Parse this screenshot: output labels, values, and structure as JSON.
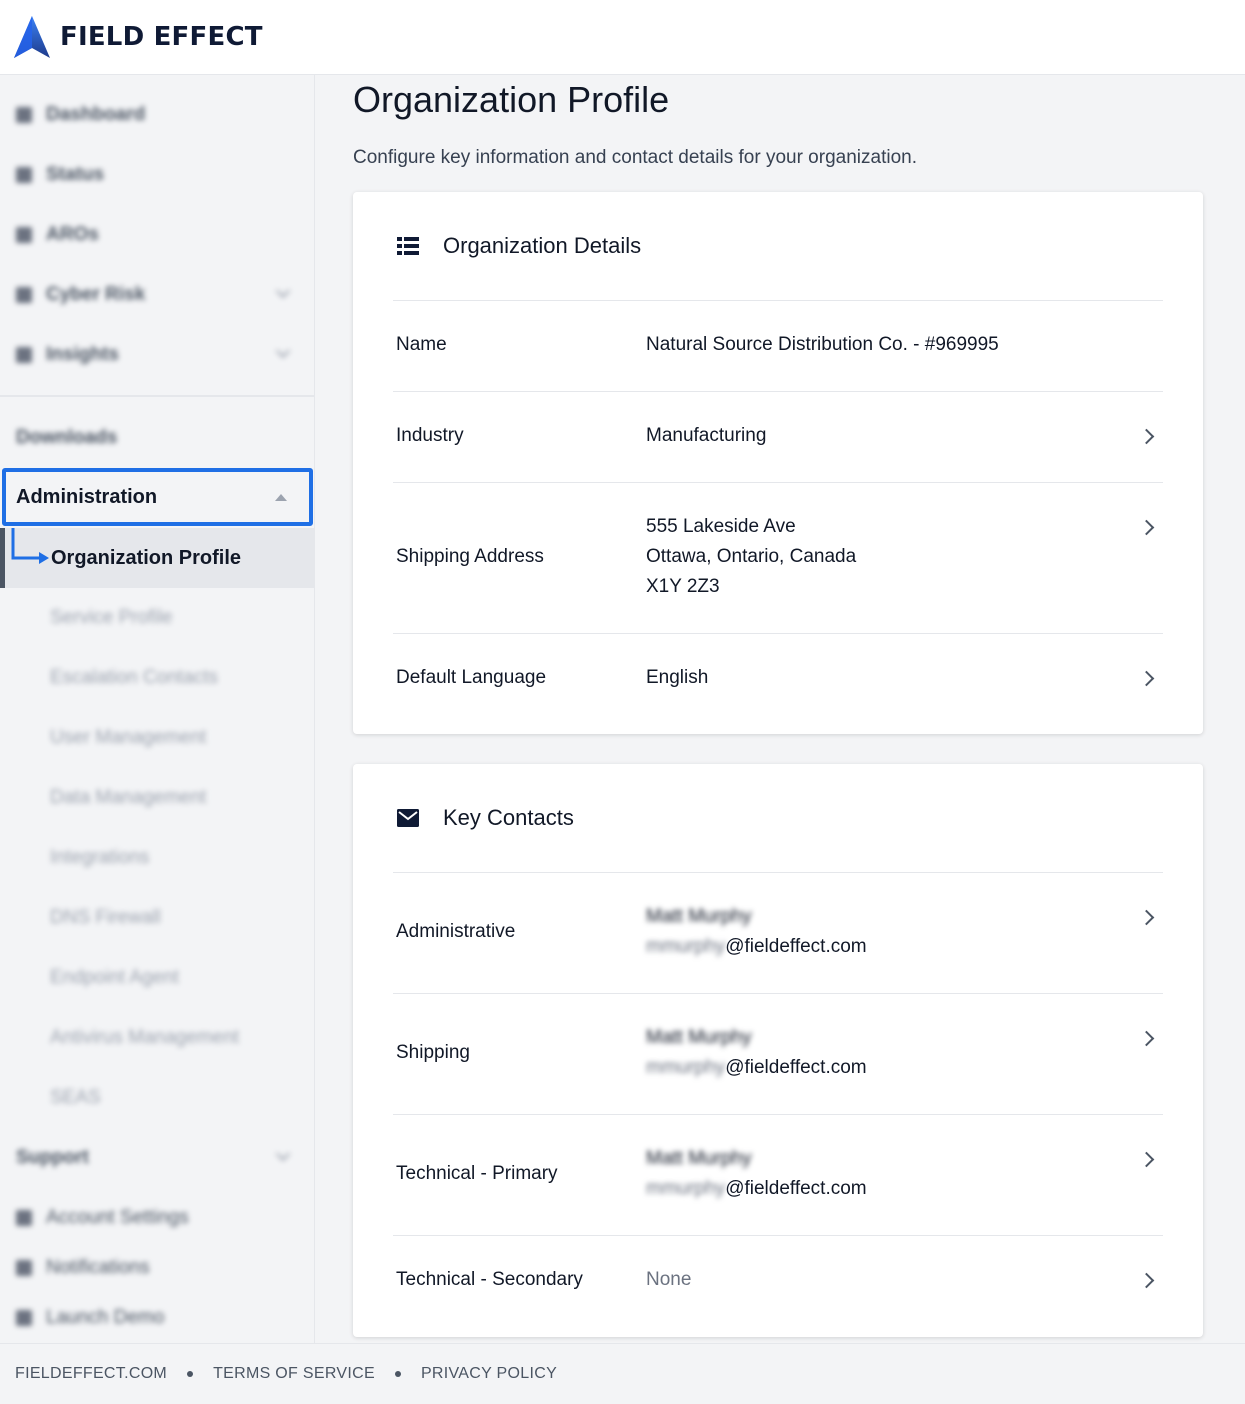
{
  "brand": {
    "name": "FIELD EFFECT",
    "accent": "#1f6fe5",
    "navy": "#0f1a35"
  },
  "sidebar": {
    "items": [
      {
        "label": "Dashboard",
        "icon": "grid-icon"
      },
      {
        "label": "Status",
        "icon": "status-icon"
      },
      {
        "label": "AROs",
        "icon": "alert-icon"
      },
      {
        "label": "Cyber Risk",
        "icon": "gauge-icon"
      },
      {
        "label": "Insights",
        "icon": "trend-icon"
      }
    ],
    "downloads_label": "Downloads",
    "administration_label": "Administration",
    "active_label": "Organization Profile",
    "sub_items": [
      "Service Profile",
      "Escalation Contacts",
      "User Management",
      "Data Management",
      "Integrations",
      "DNS Firewall",
      "Endpoint Agent",
      "Antivirus Management",
      "SEAS"
    ],
    "support_label": "Support",
    "bottom_items": [
      "Account Settings",
      "Notifications",
      "Launch Demo"
    ]
  },
  "main": {
    "title": "Organization Profile",
    "subtitle": "Configure key information and contact details for your organization.",
    "details": {
      "title": "Organization Details",
      "icon": "list-icon",
      "rows": [
        {
          "label": "Name",
          "value": "Natural Source Distribution Co. - #969995"
        },
        {
          "label": "Industry",
          "value": "Manufacturing"
        },
        {
          "label": "Shipping Address",
          "line1": "555 Lakeside Ave",
          "line2": "Ottawa, Ontario, Canada",
          "line3": "X1Y 2Z3"
        },
        {
          "label": "Default Language",
          "value": "English"
        }
      ]
    },
    "contacts": {
      "title": "Key Contacts",
      "icon": "envelope-icon",
      "rows": [
        {
          "label": "Administrative",
          "name": "Matt Murphy",
          "user": "mmurphy",
          "domain": "@fieldeffect.com"
        },
        {
          "label": "Shipping",
          "name": "Matt Murphy",
          "user": "mmurphy",
          "domain": "@fieldeffect.com"
        },
        {
          "label": "Technical - Primary",
          "name": "Matt Murphy",
          "user": "mmurphy",
          "domain": "@fieldeffect.com"
        },
        {
          "label": "Technical - Secondary",
          "value": "None"
        }
      ]
    }
  },
  "footer": {
    "links": [
      "FIELDEFFECT.COM",
      "TERMS OF SERVICE",
      "PRIVACY POLICY"
    ]
  }
}
